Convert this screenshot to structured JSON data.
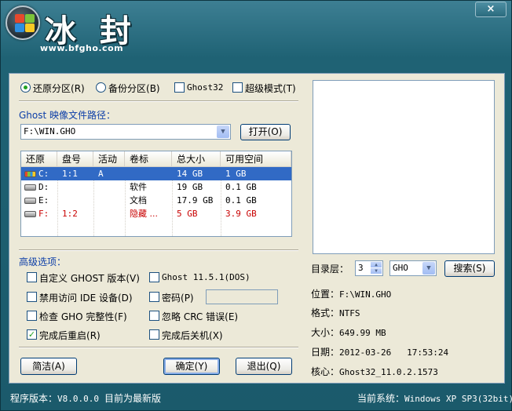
{
  "header": {
    "title": "冰 封",
    "url": "www.bfgho.com",
    "close_label": "×"
  },
  "mode": {
    "restore_label": "还原分区",
    "restore_key": "(R)",
    "backup_label": "备份分区",
    "backup_key": "(B)",
    "ghost32_label": "Ghost32",
    "super_label": "超级模式",
    "super_key": "(T)"
  },
  "image_path": {
    "label": "Ghost 映像文件路径：",
    "value": "F:\\WIN.GHO",
    "open_button": "打开(O)"
  },
  "table": {
    "headers": [
      "还原",
      "盘号",
      "活动",
      "卷标",
      "总大小",
      "可用空间"
    ],
    "rows": [
      {
        "drive": "C:",
        "disk": "1:1",
        "active": "A",
        "label": "",
        "total": "14 GB",
        "free": "1 GB"
      },
      {
        "drive": "D:",
        "disk": "",
        "active": "",
        "label": "软件",
        "total": "19 GB",
        "free": "0.1 GB"
      },
      {
        "drive": "E:",
        "disk": "",
        "active": "",
        "label": "文档",
        "total": "17.9 GB",
        "free": "0.1 GB"
      },
      {
        "drive": "F:",
        "disk": "1:2",
        "active": "",
        "label": "隐藏 ...",
        "total": "5 GB",
        "free": "3.9 GB"
      }
    ]
  },
  "advanced": {
    "title": "高级选项：",
    "custom_ghost": "自定义 GHOST 版本",
    "custom_ghost_key": "(V)",
    "ghost_version": "Ghost 11.5.1",
    "ghost_version_key": "(DOS)",
    "disable_ide": "禁用访问 IDE 设备",
    "disable_ide_key": "(D)",
    "password": "密码",
    "password_key": "(P)",
    "check_gho": "检查 GHO 完整性",
    "check_gho_key": "(F)",
    "ignore_crc": "忽略 CRC 错误",
    "ignore_crc_key": "(E)",
    "reboot": "完成后重启",
    "reboot_key": "(R)",
    "shutdown": "完成后关机",
    "shutdown_key": "(X)"
  },
  "buttons": {
    "simple": "简洁(A)",
    "ok": "确定(Y)",
    "exit": "退出(Q)",
    "search": "搜索(S)"
  },
  "right": {
    "depth_label": "目录层：",
    "depth_value": "3",
    "ext_value": "GHO",
    "location_label": "位置：",
    "location_value": "F:\\WIN.GHO",
    "format_label": "格式：",
    "format_value": "NTFS",
    "size_label": "大小：",
    "size_value": "649.99 MB",
    "date_label": "日期：",
    "date_value": "2012-03-26   17:53:24",
    "core_label": "核心：",
    "core_value": "Ghost32_11.0.2.1573"
  },
  "status": {
    "version_label": "程序版本：",
    "version_value": "V8.0.0.0",
    "latest": "目前为最新版",
    "system_label": "当前系统：",
    "system_value": "Windows XP SP3(32bit)"
  },
  "colors": {
    "frame": "#1f6274",
    "panel": "#ece9d8",
    "selection": "#316ac5",
    "hidden_row": "#c90000",
    "accent_label": "#0c3ea8"
  }
}
